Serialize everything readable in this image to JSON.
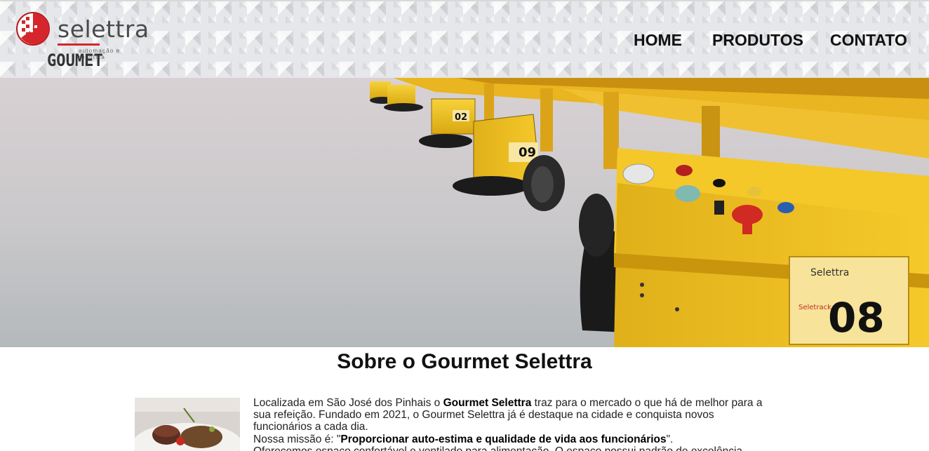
{
  "header": {
    "logo": {
      "brand": "selettra",
      "tagline": "automação e robótica",
      "sub_brand": "GOUMET"
    },
    "nav": [
      {
        "label": "HOME"
      },
      {
        "label": "PRODUTOS"
      },
      {
        "label": "CONTATO"
      }
    ]
  },
  "hero": {
    "vehicle_numbers": [
      "02",
      "09",
      "08"
    ],
    "brand_labels": [
      "Selettra",
      "Seletrack"
    ]
  },
  "about": {
    "title": "Sobre o Gourmet Selettra",
    "p1_a": "Localizada em São José dos Pinhais o ",
    "p1_b": "Gourmet Selettra",
    "p1_c": " traz para o mercado o que há de melhor para a sua refeição. Fundado em 2021, o Gourmet Selettra já é destaque na cidade e conquista novos funcionários a cada dia.",
    "p2_a": "Nossa missão é: \"",
    "p2_b": "Proporcionar auto-estima e qualidade de vida aos funcionários",
    "p2_c": "\".",
    "p3": "Oferecemos espaço confortável e ventilado para alimentação. O espaço possui padrão de excelência."
  },
  "colors": {
    "logo_red": "#d4262c",
    "robot_yellow": "#f2c31b",
    "text": "#111111"
  }
}
